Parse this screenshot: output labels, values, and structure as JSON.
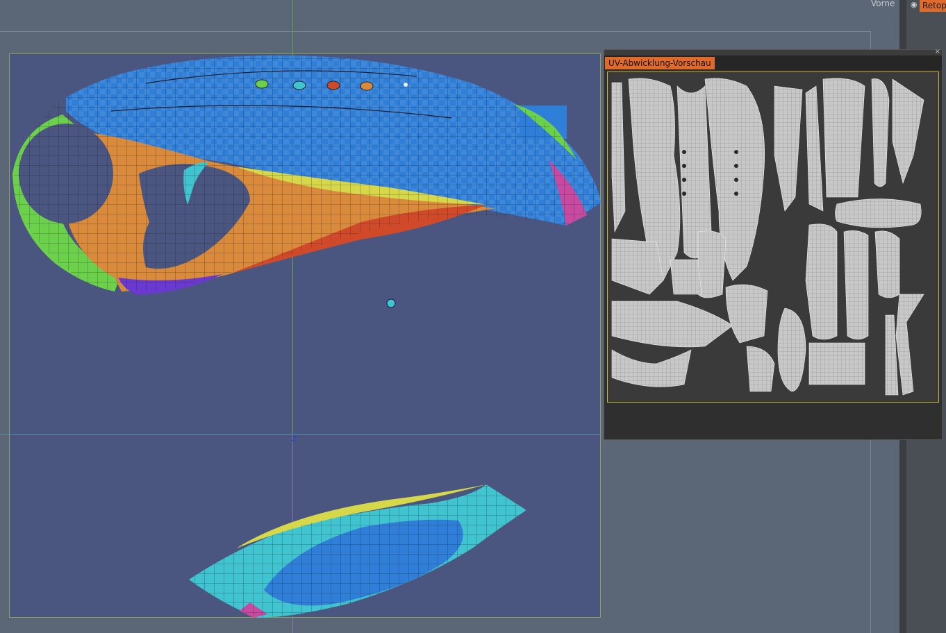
{
  "viewport": {
    "view_name": "Vorne",
    "axis_label": "Z"
  },
  "uv_panel": {
    "tab_title": "UV-Abwicklung-Vorschau",
    "close_glyph": "×"
  },
  "right_panel": {
    "retopo_tab": "Retop",
    "eye_icon": "eye-icon"
  },
  "colors": {
    "viewport_bg": "#5b6676",
    "ortho_bg": "#4a5680",
    "accent_tab": "#e06a2a",
    "uv_frame": "#c8b43a",
    "mesh_blue": "#2f7fd8",
    "mesh_orange": "#d98a3a",
    "mesh_green": "#6bd14a",
    "mesh_red": "#d04a2a",
    "mesh_yellow": "#d6d84a",
    "mesh_cyan": "#3fc4d0",
    "mesh_purple": "#6a3ad0"
  }
}
